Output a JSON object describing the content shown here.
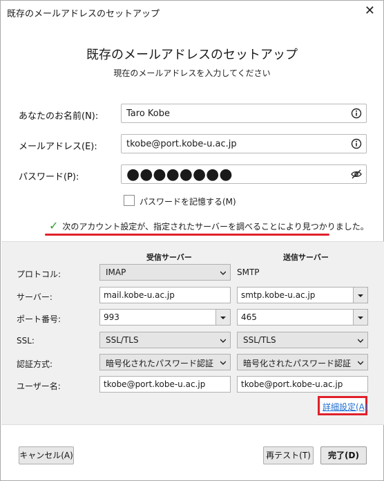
{
  "window": {
    "title": "既存のメールアドレスのセットアップ",
    "close_glyph": "✕"
  },
  "header": {
    "title": "既存のメールアドレスのセットアップ",
    "subtitle": "現在のメールアドレスを入力してください"
  },
  "form": {
    "name_label": "あなたのお名前(N):",
    "name_value": "Taro Kobe",
    "email_label": "メールアドレス(E):",
    "email_value": "tkobe@port.kobe-u.ac.jp",
    "password_label": "パスワード(P):",
    "password_value": "●●●●●●●●",
    "remember_label": "パスワードを記憶する(M)",
    "remember_checked": false
  },
  "status": {
    "message": "次のアカウント設定が、指定されたサーバーを調べることにより見つかりました。",
    "color": "#2aa02a"
  },
  "server": {
    "incoming_header": "受信サーバー",
    "outgoing_header": "送信サーバー",
    "rows": {
      "protocol": {
        "label": "プロトコル:",
        "incoming": "IMAP",
        "outgoing": "SMTP"
      },
      "server": {
        "label": "サーバー:",
        "incoming": "mail.kobe-u.ac.jp",
        "outgoing": "smtp.kobe-u.ac.jp"
      },
      "port": {
        "label": "ポート番号:",
        "incoming": "993",
        "outgoing": "465"
      },
      "ssl": {
        "label": "SSL:",
        "incoming": "SSL/TLS",
        "outgoing": "SSL/TLS"
      },
      "auth": {
        "label": "認証方式:",
        "incoming": "暗号化されたパスワード認証",
        "outgoing": "暗号化されたパスワード認証"
      },
      "username": {
        "label": "ユーザー名:",
        "incoming": "tkobe@port.kobe-u.ac.jp",
        "outgoing": "tkobe@port.kobe-u.ac.jp"
      }
    },
    "advanced_label": "詳細設定(A)"
  },
  "buttons": {
    "cancel": "キャンセル(A)",
    "retest": "再テスト(T)",
    "done": "完了(D)"
  },
  "colors": {
    "highlight": "#e0202a",
    "link": "#1f6fd1",
    "panel_bg": "#f0f0f0"
  }
}
